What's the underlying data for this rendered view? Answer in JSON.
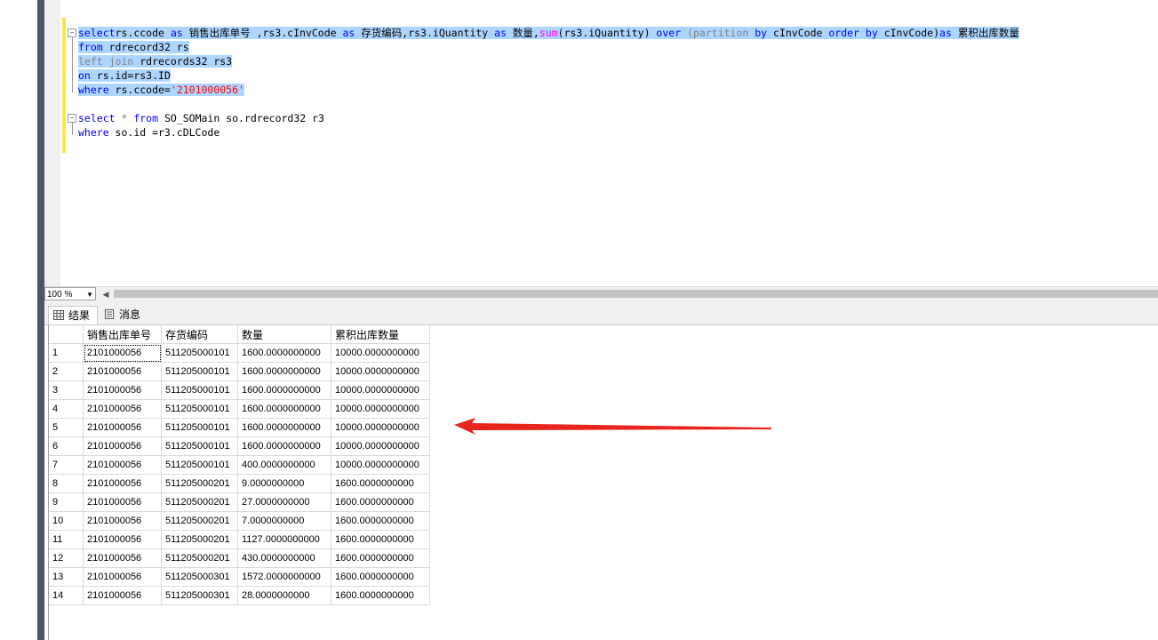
{
  "editor": {
    "lines": [
      {
        "parts": [
          [
            "kw",
            "select"
          ],
          [
            "",
            "rs.ccode "
          ],
          [
            "kw",
            "as"
          ],
          [
            "",
            " 销售出库单号 ,rs3.cInvCode "
          ],
          [
            "kw",
            "as"
          ],
          [
            "",
            " 存货编码,rs3.iQuantity "
          ],
          [
            "kw",
            "as"
          ],
          [
            "",
            " 数量,"
          ],
          [
            "fn",
            "sum"
          ],
          [
            "",
            "(rs3.iQuantity) "
          ],
          [
            "kw",
            "over"
          ],
          [
            "",
            " "
          ],
          [
            "gray",
            "(partition"
          ],
          [
            "",
            " "
          ],
          [
            "kw",
            "by"
          ],
          [
            "",
            " cInvCode "
          ],
          [
            "kw",
            "order"
          ],
          [
            "",
            " "
          ],
          [
            "kw",
            "by"
          ],
          [
            "",
            " cInvCode)"
          ],
          [
            "kw",
            "as"
          ],
          [
            "",
            " 累积出库数量"
          ]
        ]
      },
      {
        "parts": [
          [
            "kw",
            "from"
          ],
          [
            "",
            " rdrecord32 rs"
          ]
        ]
      },
      {
        "parts": [
          [
            "gray",
            "left join"
          ],
          [
            "",
            " rdrecords32 rs3"
          ]
        ]
      },
      {
        "parts": [
          [
            "kw",
            "on"
          ],
          [
            "",
            " rs.id=rs3.ID"
          ]
        ]
      },
      {
        "parts": [
          [
            "kw",
            "where"
          ],
          [
            "",
            " rs.ccode="
          ],
          [
            "str",
            "'2101000056'"
          ]
        ]
      },
      {
        "parts": []
      },
      {
        "parts": [
          [
            "kw",
            "select"
          ],
          [
            "gray",
            " * "
          ],
          [
            "kw",
            "from"
          ],
          [
            "",
            " SO_SOMain so.rdrecord32 r3"
          ]
        ]
      },
      {
        "parts": [
          [
            "kw",
            "where"
          ],
          [
            "",
            " so.id =r3.cDLCode"
          ]
        ]
      }
    ]
  },
  "zoom": {
    "value": "100 %"
  },
  "tabs": [
    {
      "label": "结果"
    },
    {
      "label": "消息"
    }
  ],
  "grid": {
    "columns": [
      "销售出库单号",
      "存货编码",
      "数量",
      "累积出库数量"
    ],
    "rows": [
      [
        "1",
        "2101000056",
        "511205000101",
        "1600.0000000000",
        "10000.0000000000"
      ],
      [
        "2",
        "2101000056",
        "511205000101",
        "1600.0000000000",
        "10000.0000000000"
      ],
      [
        "3",
        "2101000056",
        "511205000101",
        "1600.0000000000",
        "10000.0000000000"
      ],
      [
        "4",
        "2101000056",
        "511205000101",
        "1600.0000000000",
        "10000.0000000000"
      ],
      [
        "5",
        "2101000056",
        "511205000101",
        "1600.0000000000",
        "10000.0000000000"
      ],
      [
        "6",
        "2101000056",
        "511205000101",
        "1600.0000000000",
        "10000.0000000000"
      ],
      [
        "7",
        "2101000056",
        "511205000101",
        "400.0000000000",
        "10000.0000000000"
      ],
      [
        "8",
        "2101000056",
        "511205000201",
        "9.0000000000",
        "1600.0000000000"
      ],
      [
        "9",
        "2101000056",
        "511205000201",
        "27.0000000000",
        "1600.0000000000"
      ],
      [
        "10",
        "2101000056",
        "511205000201",
        "7.0000000000",
        "1600.0000000000"
      ],
      [
        "11",
        "2101000056",
        "511205000201",
        "1127.0000000000",
        "1600.0000000000"
      ],
      [
        "12",
        "2101000056",
        "511205000201",
        "430.0000000000",
        "1600.0000000000"
      ],
      [
        "13",
        "2101000056",
        "511205000301",
        "1572.0000000000",
        "1600.0000000000"
      ],
      [
        "14",
        "2101000056",
        "511205000301",
        "28.0000000000",
        "1600.0000000000"
      ]
    ]
  },
  "annotation": {
    "arrow_color": "#e8241c"
  }
}
